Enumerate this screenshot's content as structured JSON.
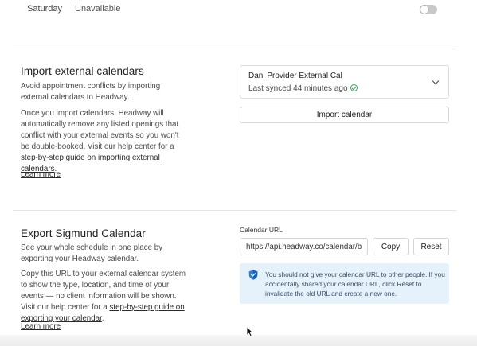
{
  "availability": {
    "day": "Saturday",
    "status": "Unavailable",
    "toggle_on": false
  },
  "import_section": {
    "title": "Import external calendars",
    "intro": "Avoid appointment conflicts by importing external calendars to Headway.",
    "body_before_link": "Once you import calendars, Headway will automatically remove any listed openings that conflict with your external events so you won't be double-booked. Visit our help center for a ",
    "link_text": "step-by-step guide on importing external calendars",
    "body_after_link": ".",
    "learn_more": "Learn more",
    "calendar": {
      "name": "Dani Provider External Cal",
      "sync_status": "Last synced 44 minutes ago"
    },
    "import_button": "Import calendar"
  },
  "export_section": {
    "title": "Export Sigmund Calendar",
    "intro": "See your whole schedule in one place by exporting your Headway calendar.",
    "body_before_link": "Copy this URL to your external calendar system to show the type, location, and time of your events — no client information will be shown. Visit our help center for a ",
    "link_text": "step-by-step guide on exporting your calendar",
    "body_after_link": ".",
    "learn_more": "Learn more",
    "url_label": "Calendar URL",
    "url_value": "https://api.headway.co/calendar/bc",
    "copy_button": "Copy",
    "reset_button": "Reset",
    "warning": "You should not give your calendar URL to other people. If you accidentally shared your calendar URL, click Reset to invalidate the old URL and create a new one."
  },
  "colors": {
    "alert_bg": "#e5f1fb",
    "shield_blue": "#2f7fd6",
    "sync_check": "#3d9a60"
  }
}
